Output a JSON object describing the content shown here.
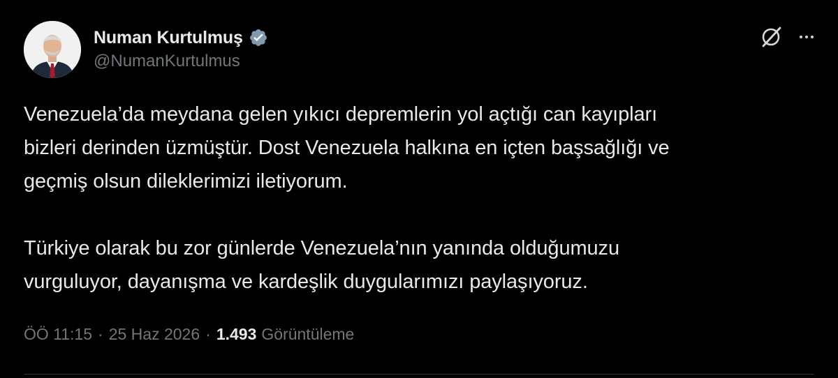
{
  "author": {
    "display_name": "Numan Kurtulmuş",
    "handle": "@NumanKurtulmus",
    "verified": true,
    "verified_color": "#829aab"
  },
  "tweet": {
    "paragraphs": [
      [
        "Venezuela’da meydana gelen yıkıcı depremlerin yol açtığı can kayıpları",
        "bizleri derinden üzmüştür. Dost Venezuela halkına en içten başsağlığı ve",
        "geçmiş olsun dileklerimizi iletiyorum."
      ],
      [
        "Türkiye olarak bu zor günlerde Venezuela’nın yanında olduğumuzu",
        "vurguluyor, dayanışma ve kardeşlik duygularımızı paylaşıyoruz."
      ]
    ]
  },
  "meta": {
    "time": "ÖÖ 11:15",
    "separator": "·",
    "date": "25 Haz 2026",
    "views_count": "1.493",
    "views_label": "Görüntüleme"
  },
  "icons": {
    "grok": "grok-icon",
    "more": "more-icon",
    "verified": "verified-badge-icon"
  },
  "colors": {
    "background": "#000000",
    "text_primary": "#e7e9ea",
    "text_secondary": "#71767b"
  }
}
